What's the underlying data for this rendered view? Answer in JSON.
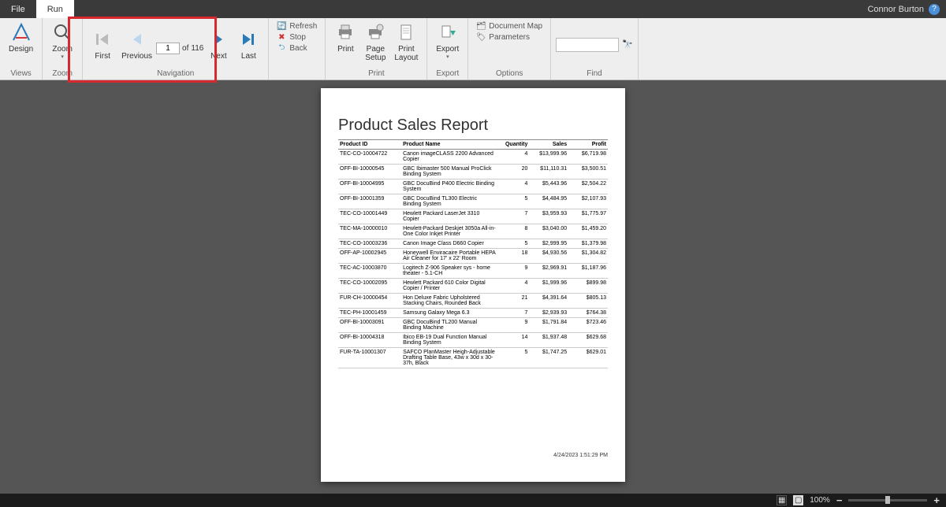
{
  "topbar": {
    "tabs": {
      "file": "File",
      "run": "Run"
    },
    "user": "Connor Burton"
  },
  "ribbon": {
    "views": {
      "design": "Design",
      "label": "Views"
    },
    "zoom": {
      "zoom": "Zoom",
      "label": "Zoom"
    },
    "navigation": {
      "first": "First",
      "previous": "Previous",
      "next": "Next",
      "last": "Last",
      "page_value": "1",
      "of": "of",
      "total": "116",
      "label": "Navigation"
    },
    "actions": {
      "refresh": "Refresh",
      "stop": "Stop",
      "back": "Back"
    },
    "print": {
      "print": "Print",
      "page_setup": "Page\nSetup",
      "print_layout": "Print\nLayout",
      "export": "Export",
      "label_print": "Print",
      "label_export": "Export"
    },
    "options": {
      "doc_map": "Document Map",
      "parameters": "Parameters",
      "label": "Options"
    },
    "find": {
      "label": "Find"
    }
  },
  "report": {
    "title": "Product Sales Report",
    "columns": {
      "id": "Product ID",
      "name": "Product Name",
      "qty": "Quantity",
      "sales": "Sales",
      "profit": "Profit"
    },
    "rows": [
      {
        "id": "TEC-CO-10004722",
        "name": "Canon imageCLASS 2200 Advanced Copier",
        "qty": "4",
        "sales": "$13,999.96",
        "profit": "$6,719.98"
      },
      {
        "id": "OFF-BI-10000545",
        "name": "GBC Ibimaster 500 Manual ProClick Binding System",
        "qty": "20",
        "sales": "$11,110.31",
        "profit": "$3,500.51"
      },
      {
        "id": "OFF-BI-10004995",
        "name": "GBC DocuBind P400 Electric Binding System",
        "qty": "4",
        "sales": "$5,443.96",
        "profit": "$2,504.22"
      },
      {
        "id": "OFF-BI-10001359",
        "name": "GBC DocuBind TL300 Electric Binding System",
        "qty": "5",
        "sales": "$4,484.95",
        "profit": "$2,107.93"
      },
      {
        "id": "TEC-CO-10001449",
        "name": "Hewlett Packard LaserJet 3310 Copier",
        "qty": "7",
        "sales": "$3,959.93",
        "profit": "$1,775.97"
      },
      {
        "id": "TEC-MA-10000010",
        "name": "Hewlett-Packard Deskjet 3050a All-in-One Color Inkjet Printer",
        "qty": "8",
        "sales": "$3,040.00",
        "profit": "$1,459.20"
      },
      {
        "id": "TEC-CO-10003236",
        "name": "Canon Image Class D660 Copier",
        "qty": "5",
        "sales": "$2,999.95",
        "profit": "$1,379.98"
      },
      {
        "id": "OFF-AP-10002945",
        "name": "Honeywell Enviracaire Portable HEPA Air Cleaner for 17' x 22' Room",
        "qty": "18",
        "sales": "$4,930.56",
        "profit": "$1,304.82"
      },
      {
        "id": "TEC-AC-10003870",
        "name": "Logitech Z-906 Speaker sys - home theater - 5.1-CH",
        "qty": "9",
        "sales": "$2,969.91",
        "profit": "$1,187.96"
      },
      {
        "id": "TEC-CO-10002095",
        "name": "Hewlett Packard 610 Color Digital Copier / Printer",
        "qty": "4",
        "sales": "$1,999.96",
        "profit": "$899.98"
      },
      {
        "id": "FUR-CH-10000454",
        "name": "Hon Deluxe Fabric Upholstered Stacking Chairs, Rounded Back",
        "qty": "21",
        "sales": "$4,391.64",
        "profit": "$805.13"
      },
      {
        "id": "TEC-PH-10001459",
        "name": "Samsung Galaxy Mega 6.3",
        "qty": "7",
        "sales": "$2,939.93",
        "profit": "$764.38"
      },
      {
        "id": "OFF-BI-10003091",
        "name": "GBC DocuBind TL200 Manual Binding Machine",
        "qty": "9",
        "sales": "$1,791.84",
        "profit": "$723.46"
      },
      {
        "id": "OFF-BI-10004318",
        "name": "Ibico EB-19 Dual Function Manual Binding System",
        "qty": "14",
        "sales": "$1,937.48",
        "profit": "$629.68"
      },
      {
        "id": "FUR-TA-10001307",
        "name": "SAFCO PlanMaster Heigh-Adjustable Drafting Table Base, 43w x 30d x 30-37h, Black",
        "qty": "5",
        "sales": "$1,747.25",
        "profit": "$629.01"
      }
    ],
    "timestamp": "4/24/2023 1:51:29 PM"
  },
  "statusbar": {
    "zoom": "100%"
  }
}
